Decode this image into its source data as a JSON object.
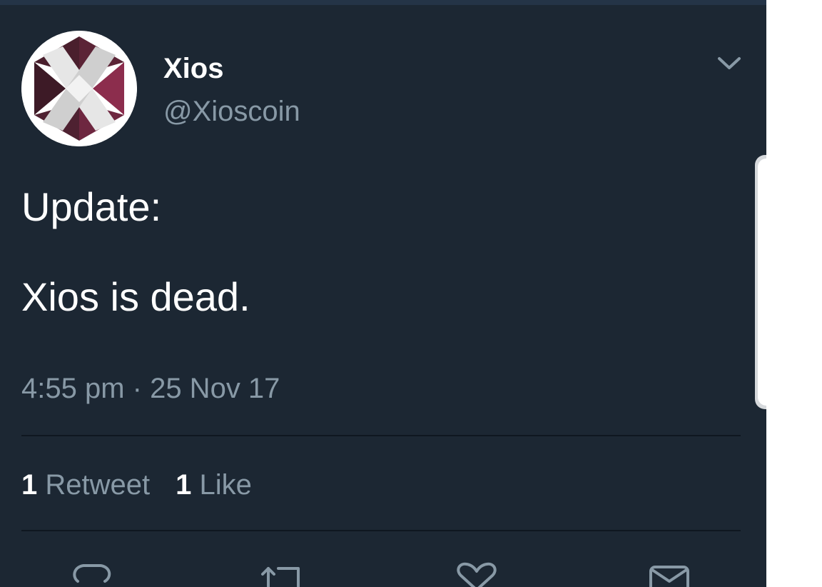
{
  "tweet": {
    "display_name": "Xios",
    "handle": "@Xioscoin",
    "text_line1": "Update:",
    "text_line2": "Xios is dead.",
    "timestamp": "4:55 pm · 25 Nov 17"
  },
  "stats": {
    "retweet_count": "1",
    "retweet_label": "Retweet",
    "like_count": "1",
    "like_label": "Like"
  },
  "icons": {
    "avatar": "xios-logo",
    "menu": "chevron-down-icon",
    "reply": "reply-icon",
    "retweet": "retweet-icon",
    "like": "heart-icon",
    "dm": "envelope-icon"
  },
  "colors": {
    "background": "#1c2733",
    "text_primary": "#ffffff",
    "text_secondary": "#8899a6",
    "logo_accent": "#7a2a45"
  }
}
